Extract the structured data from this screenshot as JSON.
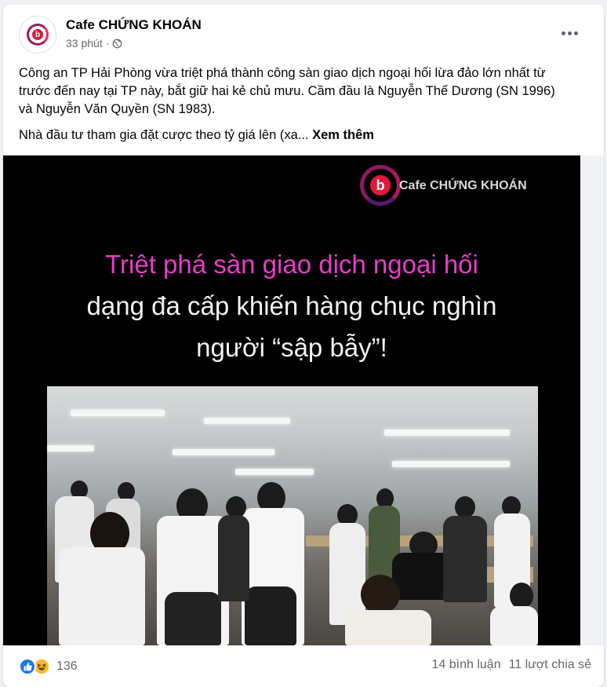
{
  "post": {
    "page_name": "Cafe CHỨNG KHOÁN",
    "time": "33 phút",
    "separator": "·",
    "paragraph_1": "Công an TP Hải Phòng vừa triệt phá thành công sàn giao dịch ngoại hối lừa đảo lớn nhất từ trước đến nay tại TP này, bắt giữ hai kẻ chủ mưu. Cầm đầu là Nguyễn Thế Dương (SN 1996) và Nguyễn Văn Quyền (SN 1983).",
    "paragraph_2": "Nhà đầu tư tham gia đặt cược theo tỷ giá lên (xa...",
    "see_more": "Xem thêm"
  },
  "media": {
    "logo_letter": "b",
    "logo_text": "Cafe CHỨNG KHOÁN",
    "headline_1": "Triệt phá sàn giao dịch ngoại hối",
    "headline_2": "dạng đa cấp khiến hàng chục nghìn",
    "headline_3": "người “sập bẫy”!"
  },
  "footer": {
    "reaction_count": "136",
    "comments": "14 bình luận",
    "shares": "11 lượt chia sẻ"
  },
  "icons": {
    "avatar_letter": "b",
    "reactions": [
      "like-icon",
      "haha-icon"
    ]
  },
  "colors": {
    "headline_accent": "#e63ec9",
    "like_blue": "#1877f2",
    "haha_yellow": "#f7b928",
    "brand_red": "#e0193a"
  }
}
